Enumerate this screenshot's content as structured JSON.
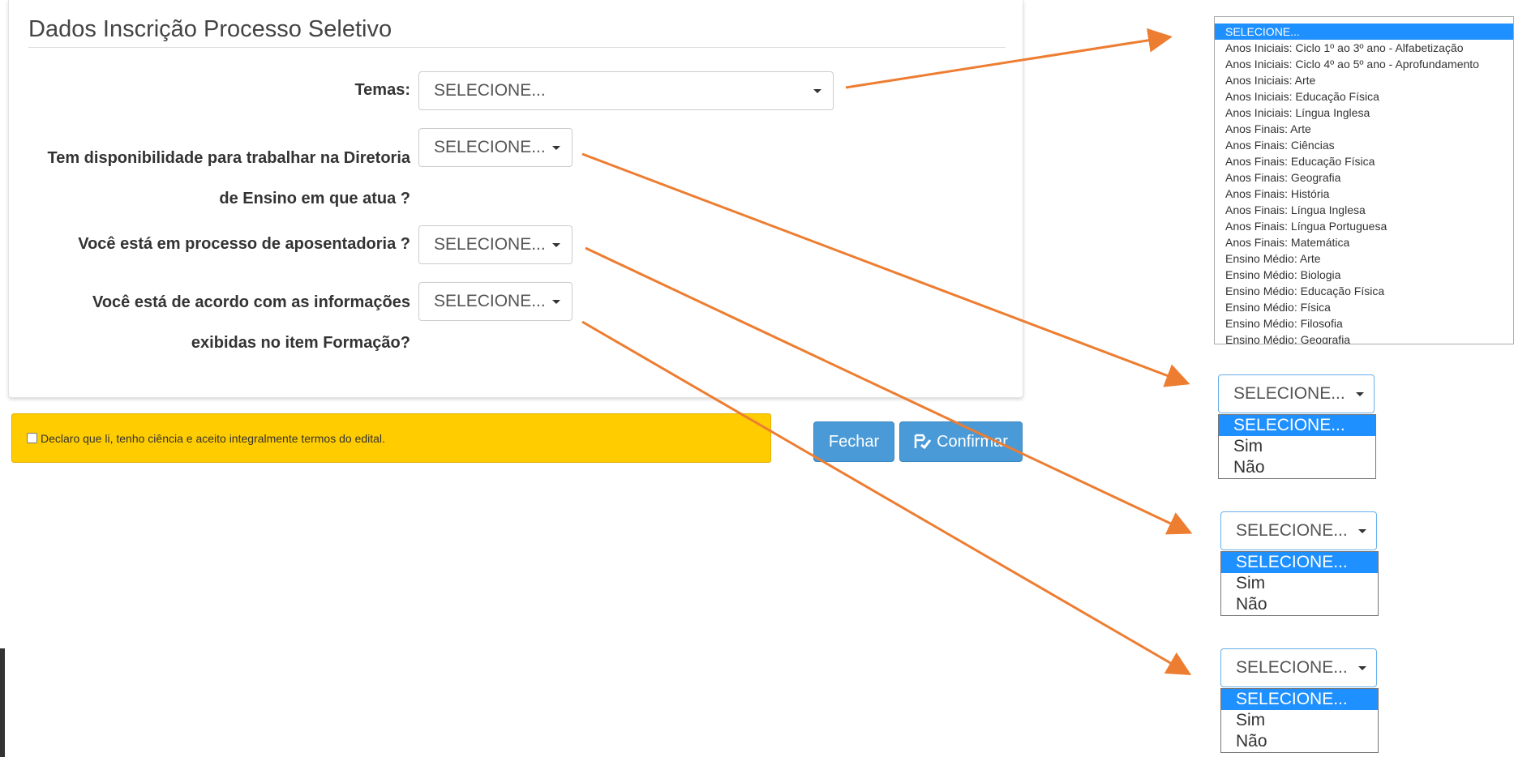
{
  "form": {
    "title": "Dados Inscrição Processo Seletivo",
    "fields": [
      {
        "label_lines": [
          "Temas:"
        ],
        "value": "SELECIONE..."
      },
      {
        "label_lines": [
          "Tem disponibilidade para trabalhar na Diretoria",
          "de Ensino em que atua ?"
        ],
        "value": "SELECIONE..."
      },
      {
        "label_lines": [
          "Você está em processo de aposentadoria ?"
        ],
        "value": "SELECIONE..."
      },
      {
        "label_lines": [
          "Você está de acordo com as informações",
          "exibidas no item Formação?"
        ],
        "value": "SELECIONE..."
      }
    ]
  },
  "notice": {
    "text": "Declaro que li, tenho ciência e aceito integralmente termos do edital.",
    "checked": false
  },
  "buttons": {
    "close": "Fechar",
    "confirm": "Confirmar"
  },
  "temas_options": [
    "SELECIONE...",
    "Anos Iniciais: Ciclo 1º ao 3º ano - Alfabetização",
    "Anos Iniciais: Ciclo 4º ao 5º ano - Aprofundamento",
    "Anos Iniciais: Arte",
    "Anos Iniciais: Educação Física",
    "Anos Iniciais: Língua Inglesa",
    "Anos Finais: Arte",
    "Anos Finais: Ciências",
    "Anos Finais: Educação Física",
    "Anos Finais: Geografia",
    "Anos Finais: História",
    "Anos Finais: Língua Inglesa",
    "Anos Finais: Língua Portuguesa",
    "Anos Finais: Matemática",
    "Ensino Médio: Arte",
    "Ensino Médio: Biologia",
    "Ensino Médio: Educação Física",
    "Ensino Médio: Física",
    "Ensino Médio: Filosofia",
    "Ensino Médio: Geografia"
  ],
  "temas_selected": "SELECIONE...",
  "yes_no_dropdowns": [
    {
      "value": "SELECIONE...",
      "options": [
        "SELECIONE...",
        "Sim",
        "Não"
      ]
    },
    {
      "value": "SELECIONE...",
      "options": [
        "SELECIONE...",
        "Sim",
        "Não"
      ]
    },
    {
      "value": "SELECIONE...",
      "options": [
        "SELECIONE...",
        "Sim",
        "Não"
      ]
    }
  ],
  "colors": {
    "arrow": "#ed7d31",
    "primary_button": "#4a9ad7",
    "notice_bg": "#ffcc00",
    "selected_option": "#1e90ff"
  }
}
